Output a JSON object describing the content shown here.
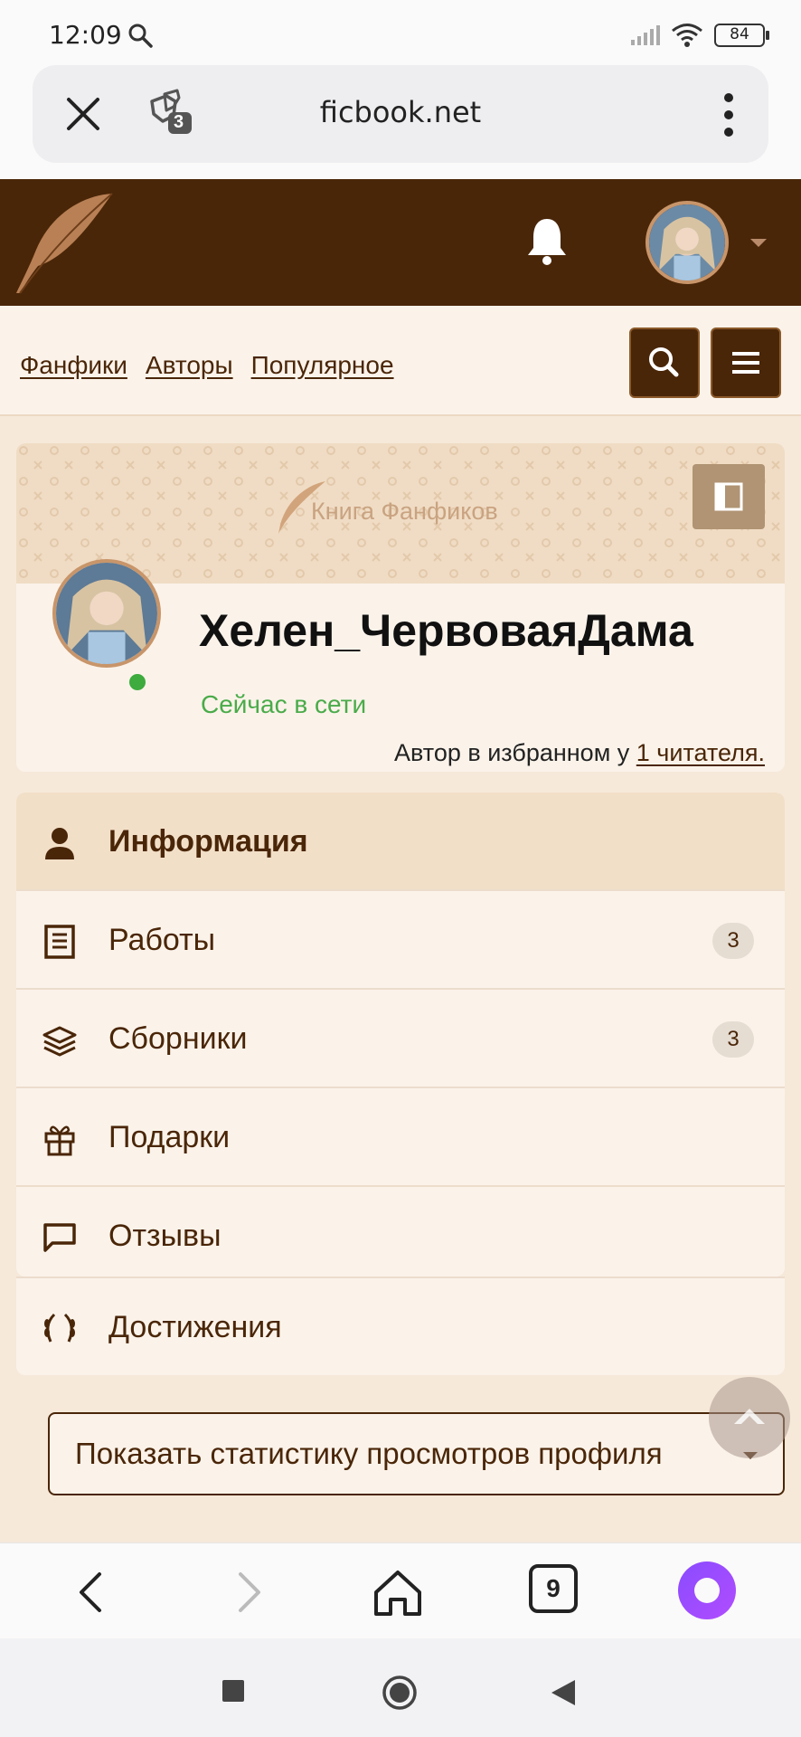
{
  "status_bar": {
    "time": "12:09",
    "battery": "84",
    "icons": [
      "search-icon",
      "signal-icon",
      "wifi-icon",
      "battery-icon"
    ]
  },
  "browser": {
    "url": "ficbook.net",
    "tabs_shield_count": "3",
    "open_tabs_count": "9"
  },
  "site_header": {
    "logo_icon": "feather-logo",
    "notifications_icon": "bell-icon"
  },
  "nav": {
    "links": [
      "Фанфики",
      "Авторы",
      "Популярное"
    ]
  },
  "profile": {
    "banner_title": "Книга Фанфиков",
    "username": "Хелен_ЧервоваяДама",
    "status": "Сейчас в сети",
    "fav_prefix": "Автор в избранном у",
    "fav_link": "1 читателя."
  },
  "menu": {
    "items": [
      {
        "label": "Информация",
        "icon": "user-icon",
        "active": true
      },
      {
        "label": "Работы",
        "icon": "document-icon",
        "badge": "3"
      },
      {
        "label": "Сборники",
        "icon": "layers-icon",
        "badge": "3"
      },
      {
        "label": "Подарки",
        "icon": "gift-icon"
      },
      {
        "label": "Отзывы",
        "icon": "comment-icon"
      },
      {
        "label": "Достижения",
        "icon": "laurel-icon"
      }
    ]
  },
  "stats_button": {
    "label": "Показать статистику просмотров профиля"
  },
  "colors": {
    "header_brown": "#4a2608",
    "page_bg": "#f6e9da",
    "card_bg": "#fbf3ea",
    "online_green": "#4aab4a"
  }
}
